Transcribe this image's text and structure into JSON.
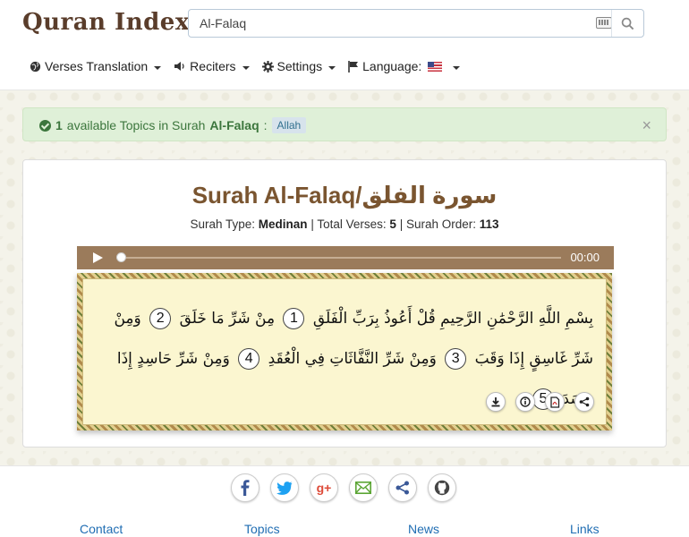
{
  "header": {
    "logo": {
      "text": "Quran Index"
    },
    "search": {
      "value": "Al-Falaq",
      "placeholder": ""
    },
    "nav": {
      "verses_translation": "Verses Translation",
      "reciters": "Reciters",
      "settings": "Settings",
      "language": "Language:"
    }
  },
  "alert": {
    "count": "1",
    "text": "available Topics in Surah",
    "surah": "Al-Falaq",
    "separator": ":",
    "topic": "Allah",
    "close": "×"
  },
  "surah": {
    "title": "Surah Al-Falaq/سورة الفلق",
    "type_label": "Surah Type:",
    "type_value": "Medinan",
    "verses_label": "| Total Verses:",
    "verses_value": "5",
    "order_label": "| Surah Order:",
    "order_value": "113"
  },
  "player": {
    "time": "00:00"
  },
  "ayat": {
    "bismillah": "بِسْمِ اللَّهِ الرَّحْمَٰنِ الرَّحِيمِ",
    "verses": [
      {
        "text": "قُلْ أَعُوذُ بِرَبِّ الْفَلَقِ",
        "num": "1"
      },
      {
        "text": "مِنْ شَرِّ مَا خَلَقَ",
        "num": "2"
      },
      {
        "text": "وَمِنْ شَرِّ غَاسِقٍ إِذَا وَقَبَ",
        "num": "3"
      },
      {
        "text": "وَمِنْ شَرِّ النَّفَّاثَاتِ فِي الْعُقَدِ",
        "num": "4"
      },
      {
        "text": "وَمِنْ شَرِّ حَاسِدٍ إِذَا حَسَدَ",
        "num": "5"
      }
    ]
  },
  "tools": [
    "download-icon",
    "info-icon",
    "pdf-icon",
    "share-icon"
  ],
  "footer": {
    "social": [
      "facebook-icon",
      "twitter-icon",
      "google-plus-icon",
      "email-icon",
      "share-icon",
      "github-icon"
    ],
    "links": {
      "contact": "Contact",
      "topics": "Topics",
      "news": "News",
      "links": "Links"
    }
  },
  "colors": {
    "brand_brown": "#7a5530",
    "player_bg": "#9b7b5b",
    "alert_bg": "#dff0d8",
    "alert_text": "#3c763d",
    "link": "#1f6db3",
    "verse_bg": "#fbf6d0"
  }
}
